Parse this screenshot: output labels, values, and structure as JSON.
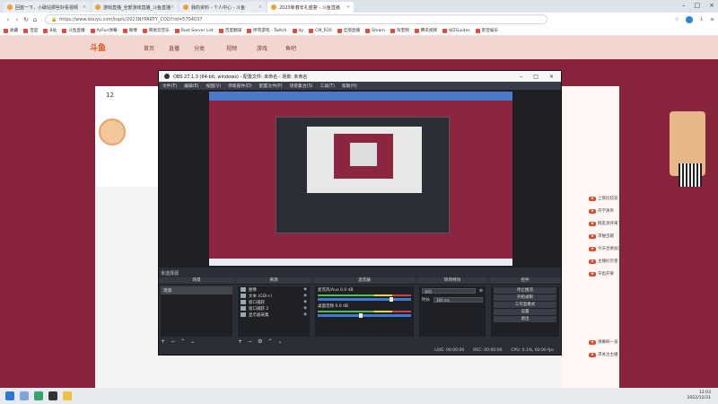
{
  "browser": {
    "tabs": [
      {
        "label": "回首一下，小破站那些好看视频",
        "active": false
      },
      {
        "label": "游戏直播_全部游戏直播_斗鱼直播",
        "active": false
      },
      {
        "label": "我的资料 - 个人中心 - 斗鱼",
        "active": false
      },
      {
        "label": "2023新春年礼盛宴 - 斗鱼直播",
        "active": true
      }
    ],
    "url": "https://www.douyu.com/topic/2023NYPARTY_COD?rid=5704037",
    "bookmarks": [
      "收藏",
      "百度",
      "B站",
      "斗鱼直播",
      "AcFun弹幕",
      "微博",
      "网易云音乐",
      "Rust Server List",
      "百度翻译",
      "所有游戏 - Twitch",
      "dy",
      "CM_R20",
      "全部直播",
      "Steam",
      "淘宝网",
      "腾讯视频",
      "WZGuides",
      "影音娱乐"
    ]
  },
  "page": {
    "nav": [
      "首页",
      "直播",
      "分类",
      "视频",
      "游戏",
      "鱼吧"
    ],
    "follow_count": "12",
    "chat_lines": [
      "上限比较高",
      "开学清单",
      "网友测评来了",
      "求抽宝箱",
      "今天也要加油",
      "主播好厉害",
      "牙齿开果",
      "弹幕刷一波",
      "求关注主播"
    ]
  },
  "obs": {
    "title": "OBS 27.1.3 (64-bit, windows) - 配置文件: 未命名 - 场景: 未命名",
    "menu": [
      "文件(F)",
      "编辑(E)",
      "视图(V)",
      "停靠部件(D)",
      "配置文件(P)",
      "场景集合(S)",
      "工具(T)",
      "帮助(H)"
    ],
    "preview_label": "未选择源",
    "docks": {
      "scenes": {
        "title": "场景",
        "items": [
          "场景"
        ]
      },
      "sources": {
        "title": "来源",
        "items": [
          "图像",
          "文本 (GDI+)",
          "窗口捕获",
          "窗口捕获 2",
          "显示器采集"
        ]
      },
      "mixer": {
        "title": "混音器",
        "rows": [
          {
            "name": "麦克风/Aux",
            "db": "0.0 dB"
          },
          {
            "name": "桌面音频",
            "db": "0.0 dB"
          }
        ]
      },
      "transitions": {
        "title": "转场特效",
        "type": "淡出",
        "duration_label": "时长",
        "duration": "300 ms"
      },
      "controls": {
        "title": "控件",
        "buttons": [
          "停止推流",
          "开始录制",
          "工作室模式",
          "设置",
          "退出"
        ]
      }
    },
    "status": [
      "LIVE: 00:00:00",
      "REC: 00:00:00",
      "CPU: 0.1%, 60.00 fps"
    ]
  },
  "taskbar": {
    "time": "12:03",
    "date": "2022/12/31"
  }
}
